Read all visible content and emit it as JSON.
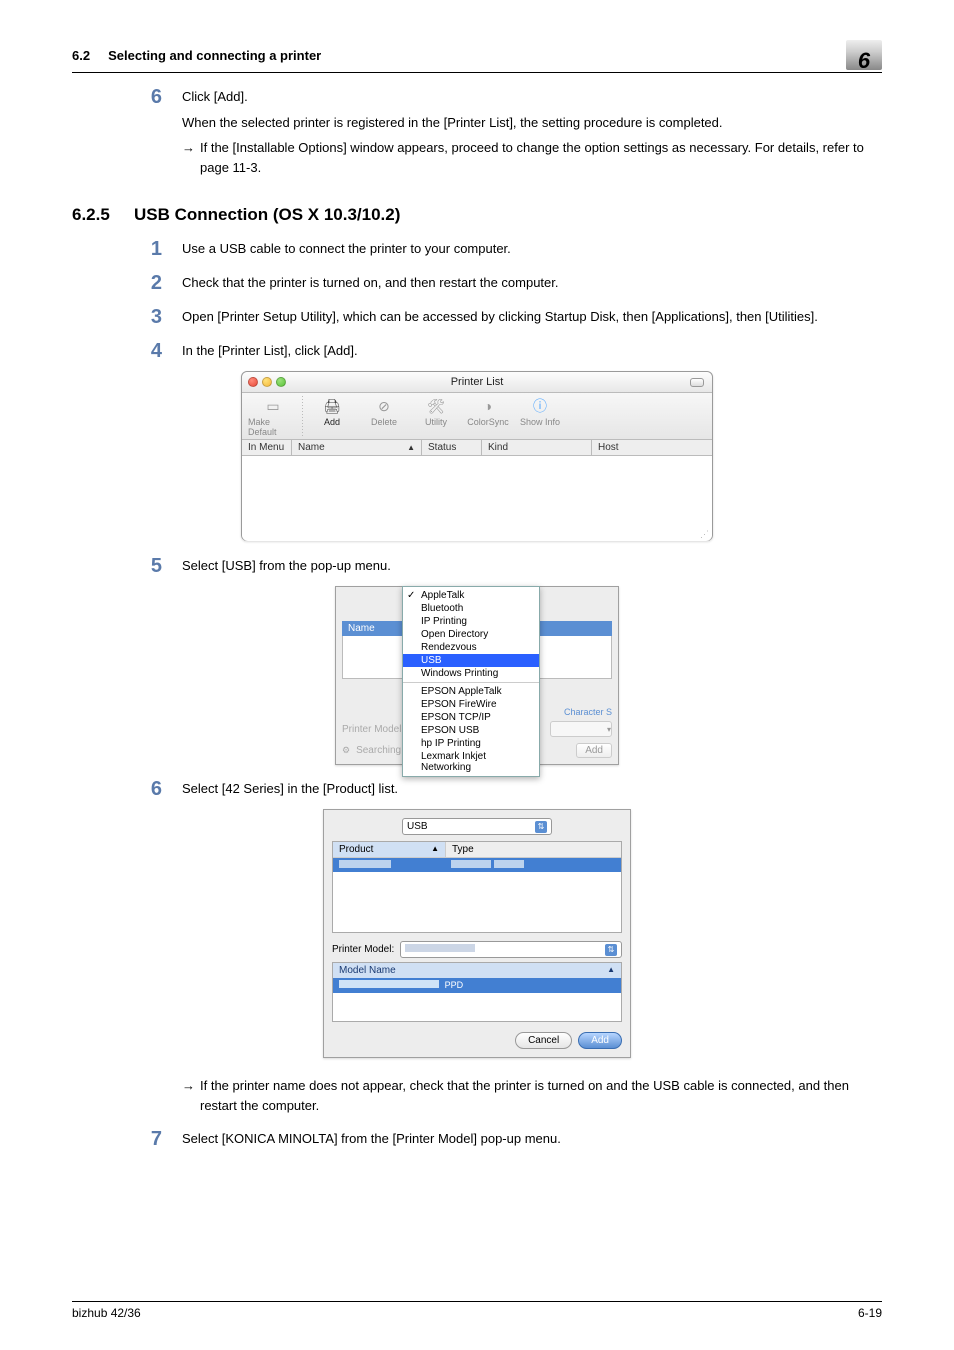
{
  "header": {
    "section_number": "6.2",
    "section_title": "Selecting and connecting a printer",
    "chapter_badge": "6"
  },
  "pre_steps": {
    "num6": "6",
    "text6": "Click [Add].",
    "text6_sub": "When the selected printer is registered in the [Printer List], the setting procedure is completed.",
    "text6_arrow": "If the [Installable Options] window appears, proceed to change the option settings as necessary. For details, refer to page 11-3."
  },
  "section": {
    "num": "6.2.5",
    "title": "USB Connection (OS X 10.3/10.2)"
  },
  "steps": {
    "s1_num": "1",
    "s1_text": "Use a USB cable to connect the printer to your computer.",
    "s2_num": "2",
    "s2_text": "Check that the printer is turned on, and then restart the computer.",
    "s3_num": "3",
    "s3_text": "Open [Printer Setup Utility], which can be accessed by clicking Startup Disk, then [Applications], then [Utilities].",
    "s4_num": "4",
    "s4_text": "In the [Printer List], click [Add].",
    "s5_num": "5",
    "s5_text": "Select [USB] from the pop-up menu.",
    "s6_num": "6",
    "s6_text": "Select [42 Series] in the [Product] list.",
    "s6_arrow": "If the printer name does not appear, check that the printer is turned on and the USB cable is connected, and then restart the computer.",
    "s7_num": "7",
    "s7_text": "Select [KONICA MINOLTA] from the [Printer Model] pop-up menu."
  },
  "win1": {
    "title": "Printer List",
    "tb_make_default": "Make Default",
    "tb_add": "Add",
    "tb_delete": "Delete",
    "tb_utility": "Utility",
    "tb_colorsync": "ColorSync",
    "tb_showinfo": "Show Info",
    "col_inmenu": "In Menu",
    "col_name": "Name",
    "col_status": "Status",
    "col_kind": "Kind",
    "col_host": "Host"
  },
  "win2": {
    "menu": {
      "appletalk": "AppleTalk",
      "bluetooth": "Bluetooth",
      "ipprinting": "IP Printing",
      "opendir": "Open Directory",
      "rendezvous": "Rendezvous",
      "usb": "USB",
      "winprint": "Windows Printing",
      "eps_at": "EPSON AppleTalk",
      "eps_fw": "EPSON FireWire",
      "eps_tcp": "EPSON TCP/IP",
      "eps_usb": "EPSON USB",
      "hp_ip": "hp IP Printing",
      "lexmark": "Lexmark Inkjet Networking"
    },
    "labels": {
      "name": "Name",
      "charset": "Character S",
      "printer_model": "Printer Model:",
      "searching": "Searching for",
      "add": "Add"
    }
  },
  "win3": {
    "combo_value": "USB",
    "th_product": "Product",
    "th_type": "Type",
    "printer_model": "Printer Model:",
    "th_modelname": "Model Name",
    "subcol_ppd": "PPD",
    "cancel": "Cancel",
    "add": "Add"
  },
  "arrow": "→",
  "footer": {
    "left": "bizhub 42/36",
    "right": "6-19"
  }
}
